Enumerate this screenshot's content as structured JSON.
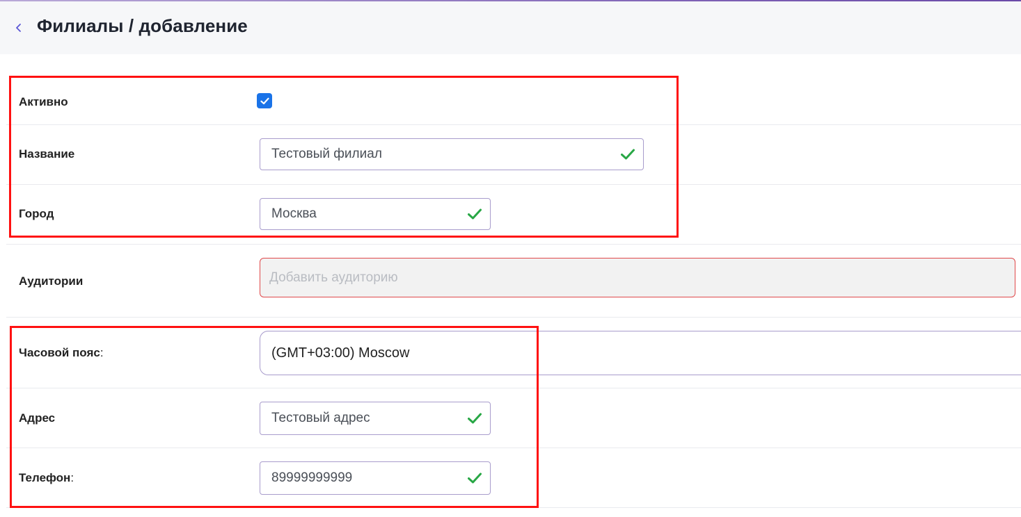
{
  "header": {
    "title": "Филиалы / добавление"
  },
  "form": {
    "active": {
      "label": "Активно",
      "checked": true
    },
    "name": {
      "label": "Название",
      "value": "Тестовый филиал"
    },
    "city": {
      "label": "Город",
      "value": "Москва"
    },
    "auditoriums": {
      "label": "Аудитории",
      "placeholder": "Добавить аудиторию"
    },
    "timezone": {
      "label": "Часовой пояс",
      "colon": ":",
      "value": "(GMT+03:00) Moscow"
    },
    "address": {
      "label": "Адрес",
      "value": "Тестовый адрес"
    },
    "phone": {
      "label": "Телефон",
      "colon": ":",
      "value": "89999999999"
    }
  },
  "colors": {
    "highlight": "#ff1111",
    "checkbox": "#1a73e8",
    "valid_check": "#28a745",
    "error_border": "#e0484a"
  },
  "icons": {
    "back": "chevron-left-icon",
    "valid": "check-icon",
    "checkbox": "checkmark-icon"
  }
}
